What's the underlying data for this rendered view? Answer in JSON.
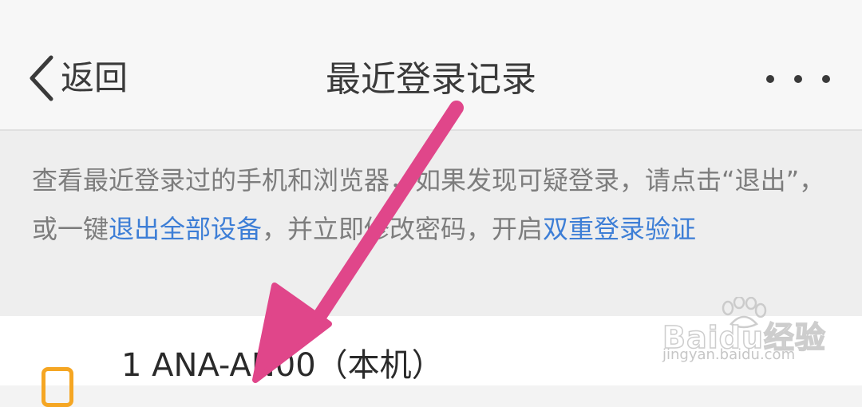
{
  "header": {
    "back_label": "返回",
    "title": "最近登录记录",
    "more_icon": "more-dots-icon"
  },
  "notice": {
    "text_1": "查看最近登录过的手机和浏览器，如果发现可疑登录，请点击“退出”，或一键",
    "link_logout_all": "退出全部设备",
    "text_2": "，并立即修改密码，开启",
    "link_two_step": "双重登录验证"
  },
  "devices": [
    {
      "name": "1 ANA-AN00（本机）",
      "icon": "phone-icon"
    }
  ],
  "watermark": {
    "brand": "Baidu经验",
    "url": "jingyan.baidu.com"
  },
  "colors": {
    "link": "#3d7ed6",
    "annotation_arrow": "#e0468a",
    "device_icon": "#f5a623"
  }
}
